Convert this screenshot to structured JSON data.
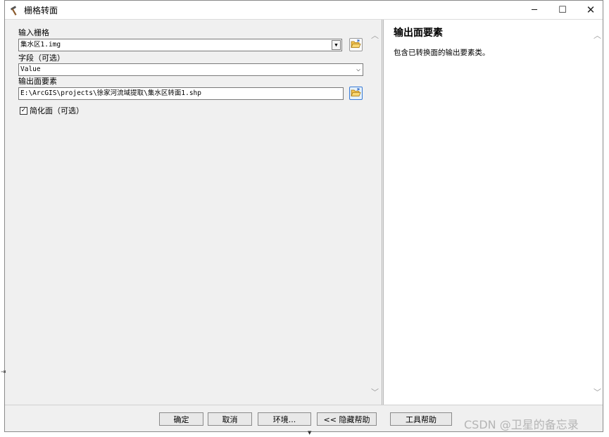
{
  "window": {
    "title": "栅格转面",
    "min_symbol": "─",
    "max_symbol": "☐",
    "close_symbol": "✕",
    "icon": "hammer-icon"
  },
  "form": {
    "input_raster": {
      "label": "输入栅格",
      "value": "集水区1.img"
    },
    "field": {
      "label": "字段（可选）",
      "value": "Value"
    },
    "output_features": {
      "label": "输出面要素",
      "value": "E:\\ArcGIS\\projects\\徐家河流域提取\\集水区转面1.shp"
    },
    "simplify": {
      "label": "简化面（可选）",
      "checked": true,
      "check_mark": "✓"
    }
  },
  "help": {
    "title": "输出面要素",
    "text": "包含已转换面的输出要素类。"
  },
  "buttons": {
    "ok": "确定",
    "cancel": "取消",
    "environments": "环境...",
    "hide_help": "<< 隐藏帮助",
    "tool_help": "工具帮助"
  },
  "watermark": "CSDN @卫星的备忘录",
  "colors": {
    "window_bg": "#f0f0f0",
    "focus_border": "#3a7bd5"
  }
}
